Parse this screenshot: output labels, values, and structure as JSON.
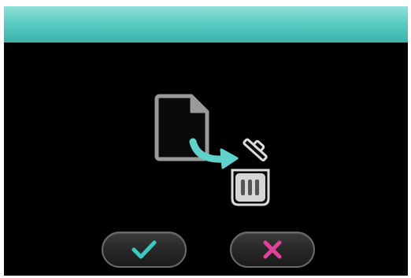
{
  "dialog": {
    "illustration": {
      "icons": [
        "document-icon",
        "arrow-icon",
        "trash-bin-icon"
      ],
      "colors": {
        "outline": "#9a9a9a",
        "arrow": "#5fd3cb",
        "bin": "#dcdcdc"
      }
    },
    "buttons": {
      "confirm": {
        "icon": "checkmark-icon",
        "color": "#3fc7bf"
      },
      "cancel": {
        "icon": "cross-icon",
        "color": "#e2409a"
      }
    }
  },
  "theme": {
    "title_bar_color": "#5ccdc4",
    "background": "#000000"
  }
}
